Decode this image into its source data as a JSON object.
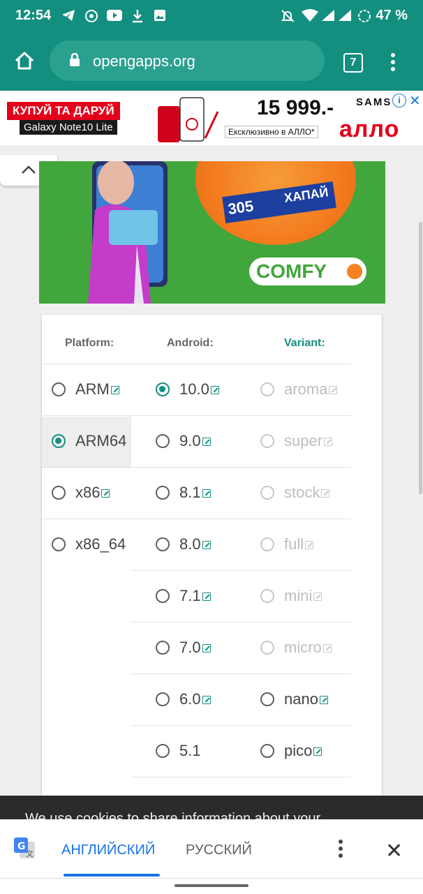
{
  "status_bar": {
    "time": "12:54",
    "battery": "47 %",
    "left_icons": [
      "telegram-icon",
      "network-icon",
      "youtube-icon",
      "download-icon",
      "image-icon"
    ],
    "right_icons": [
      "mute-icon",
      "wifi-icon",
      "signal-icon",
      "signal-icon",
      "battery-saver-icon"
    ]
  },
  "browser": {
    "url": "opengapps.org",
    "tab_count": "7"
  },
  "ad": {
    "headline": "КУПУЙ ТА ДАРУЙ",
    "product": "Galaxy Note10 Lite",
    "price": "15 999.-",
    "exclusive": "Ексклюзивно в АЛЛО*",
    "brand_top": "SAMS",
    "brand": "алло"
  },
  "banner": {
    "promo_number": "305",
    "promo_text": "ХАПАЙ",
    "brand": "COMFY"
  },
  "selector": {
    "headers": {
      "platform": "Platform:",
      "android": "Android:",
      "variant": "Variant:"
    },
    "platforms": [
      {
        "label": "ARM",
        "selected": false,
        "link": true
      },
      {
        "label": "ARM64",
        "selected": true,
        "link": false
      },
      {
        "label": "x86",
        "selected": false,
        "link": true
      },
      {
        "label": "x86_64",
        "selected": false,
        "link": false
      }
    ],
    "android_versions": [
      {
        "label": "10.0",
        "selected": true,
        "link": true
      },
      {
        "label": "9.0",
        "selected": false,
        "link": true
      },
      {
        "label": "8.1",
        "selected": false,
        "link": true
      },
      {
        "label": "8.0",
        "selected": false,
        "link": true
      },
      {
        "label": "7.1",
        "selected": false,
        "link": true
      },
      {
        "label": "7.0",
        "selected": false,
        "link": true
      },
      {
        "label": "6.0",
        "selected": false,
        "link": true
      },
      {
        "label": "5.1",
        "selected": false,
        "link": false
      }
    ],
    "variants": [
      {
        "label": "aroma",
        "enabled": false
      },
      {
        "label": "super",
        "enabled": false
      },
      {
        "label": "stock",
        "enabled": false
      },
      {
        "label": "full",
        "enabled": false
      },
      {
        "label": "mini",
        "enabled": false
      },
      {
        "label": "micro",
        "enabled": false
      },
      {
        "label": "nano",
        "enabled": true
      },
      {
        "label": "pico",
        "enabled": true
      }
    ]
  },
  "cookie_bar": {
    "text": "We use cookies to share information about your"
  },
  "translate_bar": {
    "language_active": "АНГЛИЙСКИЙ",
    "language_other": "РУССКИЙ"
  },
  "colors": {
    "primary": "#138f80",
    "url_bar": "#2aa08f",
    "banner_green": "#41a63c",
    "translate_blue": "#1a73e8"
  }
}
